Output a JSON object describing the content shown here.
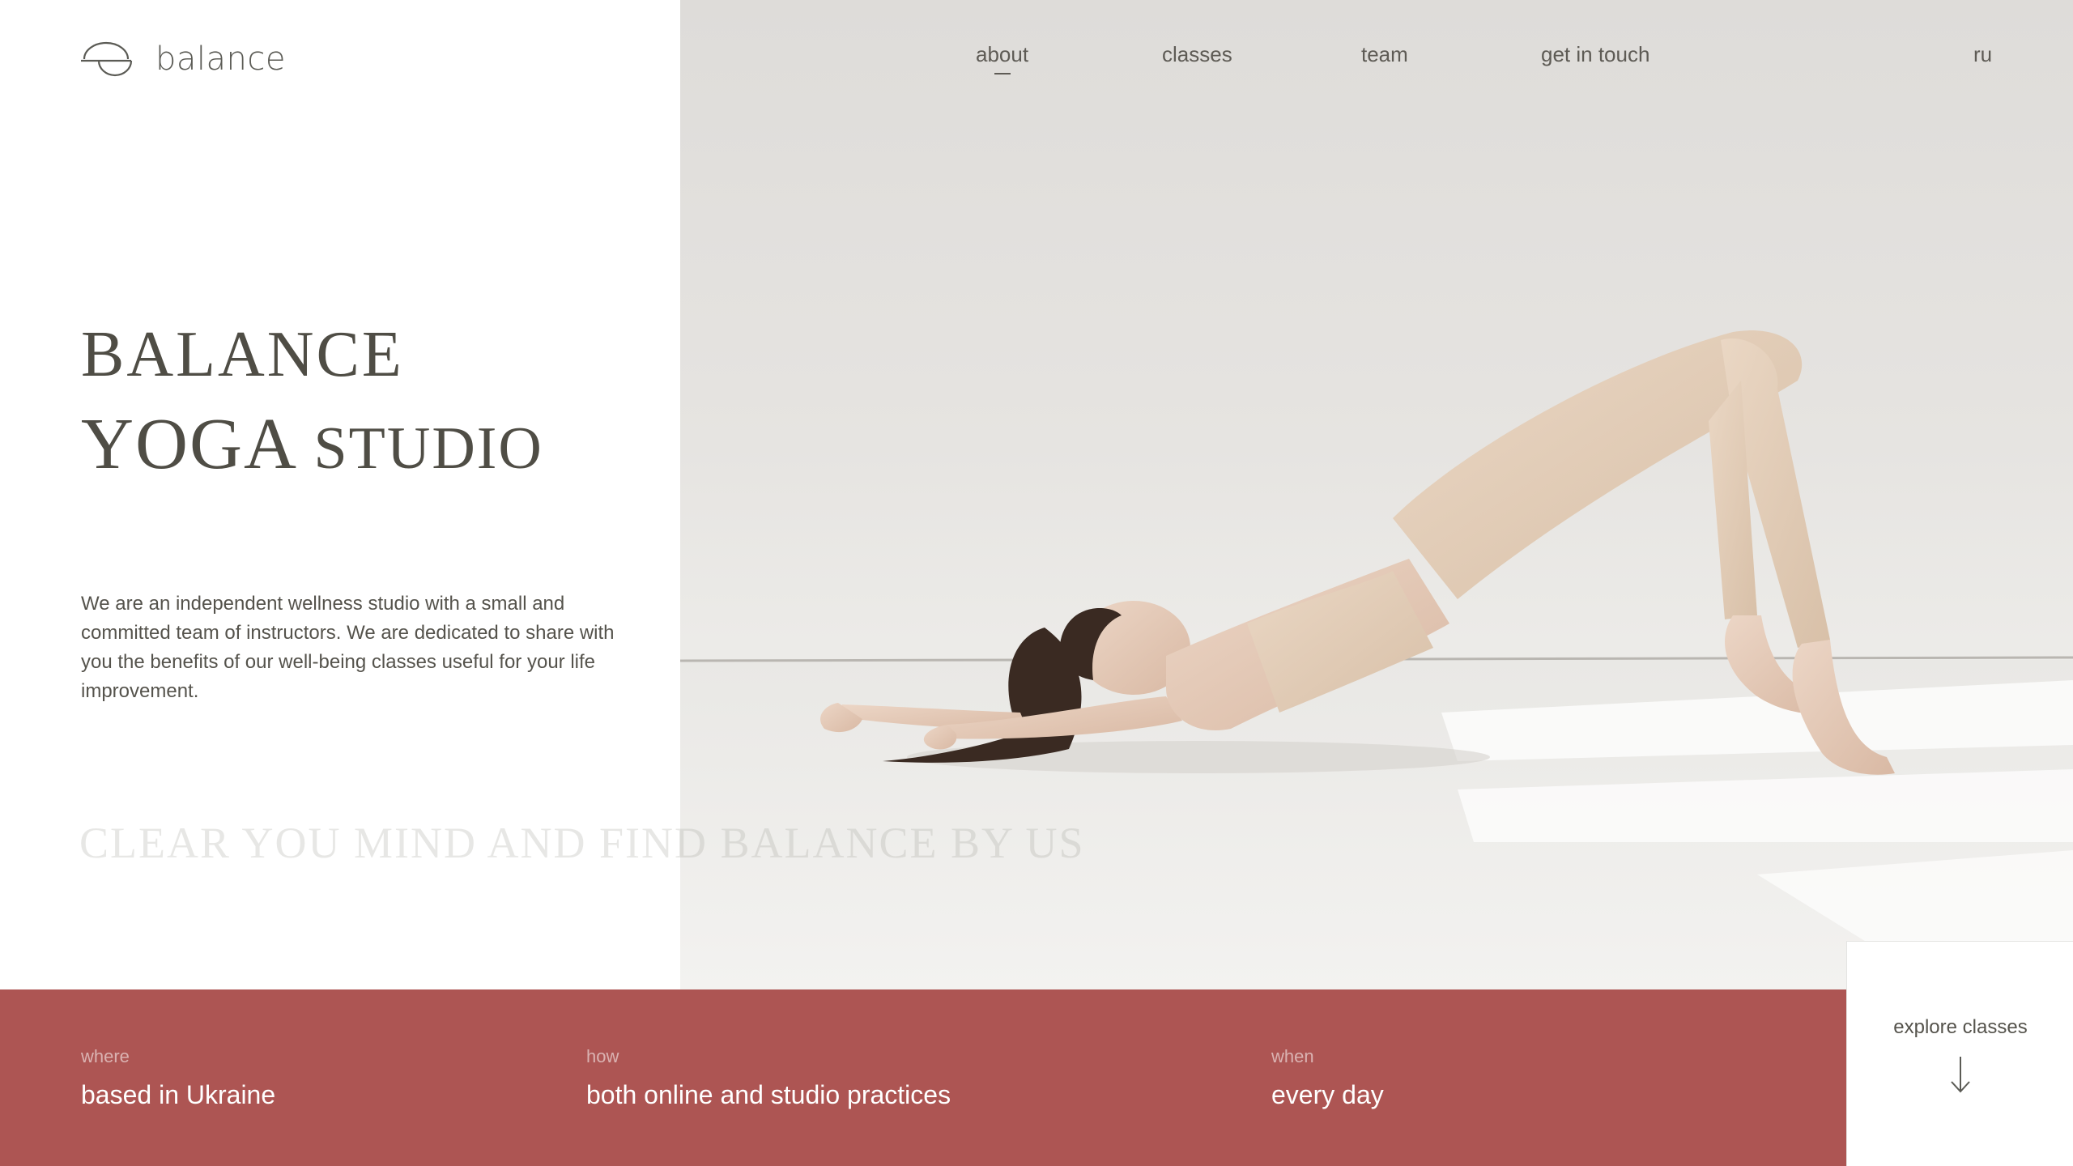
{
  "brand": {
    "name": "balance",
    "logo_icon": "half-circle-logo-icon"
  },
  "nav": {
    "items": [
      {
        "label": "about",
        "active": true
      },
      {
        "label": "classes",
        "active": false
      },
      {
        "label": "team",
        "active": false
      },
      {
        "label": "get in touch",
        "active": false
      }
    ],
    "language": "ru"
  },
  "hero": {
    "title_line1": "BALANCE",
    "title_line2_big": "YOGA",
    "title_line2_small": "STUDIO",
    "description": "We are an independent wellness studio with a small and committed team of instructors. We are dedicated to share with you the benefits of our well-being classes useful for your life improvement.",
    "tagline": "CLEAR YOU MIND AND FIND BALANCE BY US"
  },
  "info": [
    {
      "label": "where",
      "value": "based in Ukraine"
    },
    {
      "label": "how",
      "value": "both online and studio practices"
    },
    {
      "label": "when",
      "value": "every day"
    }
  ],
  "explore": {
    "label": "explore classes",
    "icon": "arrow-down-icon"
  },
  "colors": {
    "accent": "#ad5553",
    "text": "#4f4d45",
    "background": "#ffffff",
    "photo_wall": "#dedcd9"
  }
}
